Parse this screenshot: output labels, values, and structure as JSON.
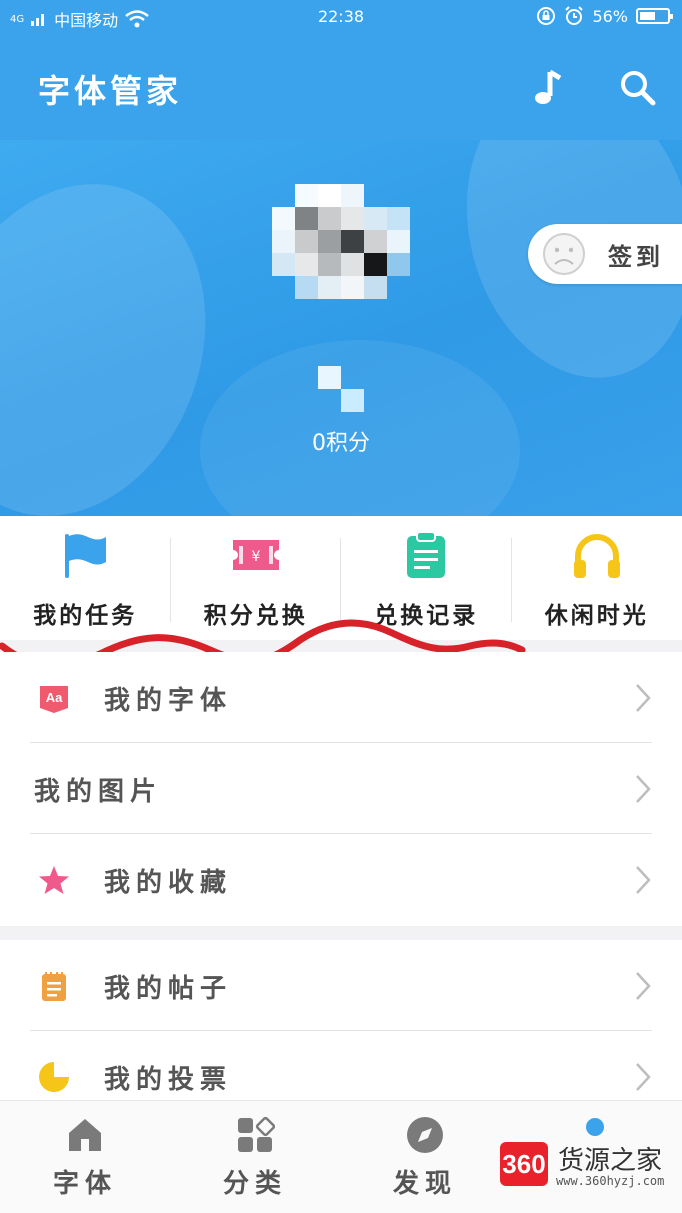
{
  "status_bar": {
    "network": "4G",
    "carrier": "中国移动",
    "time": "22:38",
    "battery": "56%",
    "battery_level": 0.56,
    "icons": [
      "signal-icon",
      "wifi-icon",
      "lock-rotation-icon",
      "alarm-icon",
      "battery-icon"
    ]
  },
  "app_bar": {
    "title": "字体管家",
    "icons": [
      "music-note-icon",
      "search-icon"
    ]
  },
  "profile": {
    "points": "0积分",
    "checkin_label": "签到",
    "checkin_icon": "sad-face-icon"
  },
  "quick_actions": [
    {
      "label": "我的任务",
      "icon": "flag-icon",
      "color": "#3aa3ec"
    },
    {
      "label": "积分兑换",
      "icon": "ticket-icon",
      "color": "#ef5a8c"
    },
    {
      "label": "兑换记录",
      "icon": "clipboard-icon",
      "color": "#2bc9a2"
    },
    {
      "label": "休闲时光",
      "icon": "headphones-icon",
      "color": "#f5c518"
    }
  ],
  "menu_group_1": [
    {
      "label": "我的字体",
      "icon": "font-aa-icon",
      "color": "#ef5a6f"
    },
    {
      "label": "我的图片",
      "icon": "",
      "color": ""
    },
    {
      "label": "我的收藏",
      "icon": "star-icon",
      "color": "#ef5a8c"
    }
  ],
  "menu_group_2": [
    {
      "label": "我的帖子",
      "icon": "notepad-icon",
      "color": "#f0a040"
    },
    {
      "label": "我的投票",
      "icon": "pie-chart-icon",
      "color": "#f5c518"
    }
  ],
  "bottom_nav": [
    {
      "label": "字体",
      "icon": "home-icon"
    },
    {
      "label": "分类",
      "icon": "category-grid-icon"
    },
    {
      "label": "发现",
      "icon": "compass-icon"
    },
    {
      "label": "",
      "icon": "profile-icon"
    }
  ],
  "watermark": {
    "logo": "360",
    "name": "货源之家",
    "url": "www.360hyzj.com"
  },
  "colors": {
    "primary": "#3aa3ec",
    "annotation_scribble": "#d8222a"
  }
}
